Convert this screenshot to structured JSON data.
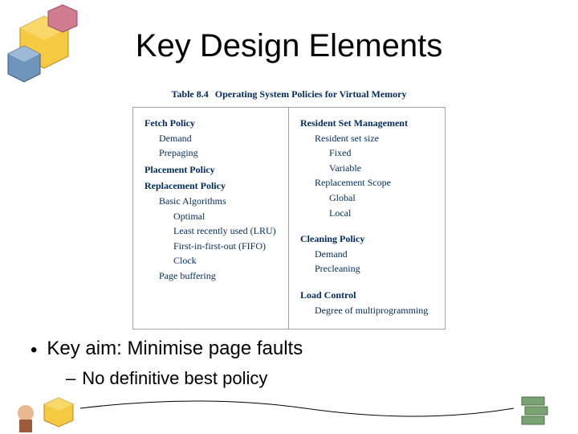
{
  "title": "Key Design Elements",
  "table": {
    "caption_num": "Table 8.4",
    "caption_text": "Operating System Policies for Virtual Memory",
    "left": {
      "fetch": {
        "heading": "Fetch Policy",
        "items": [
          "Demand",
          "Prepaging"
        ]
      },
      "placement": {
        "heading": "Placement Policy"
      },
      "replacement": {
        "heading": "Replacement Policy",
        "sub_heading": "Basic Algorithms",
        "items": [
          "Optimal",
          "Least recently used (LRU)",
          "First-in-first-out (FIFO)",
          "Clock"
        ],
        "trailing": "Page buffering"
      }
    },
    "right": {
      "resident": {
        "heading": "Resident Set Management",
        "size_label": "Resident set size",
        "size_items": [
          "Fixed",
          "Variable"
        ],
        "scope_label": "Replacement Scope",
        "scope_items": [
          "Global",
          "Local"
        ]
      },
      "cleaning": {
        "heading": "Cleaning Policy",
        "items": [
          "Demand",
          "Precleaning"
        ]
      },
      "load": {
        "heading": "Load Control",
        "items": [
          "Degree of multiprogramming"
        ]
      }
    }
  },
  "bullets": {
    "main": "Key aim: Minimise page faults",
    "sub": "No definitive best policy"
  }
}
